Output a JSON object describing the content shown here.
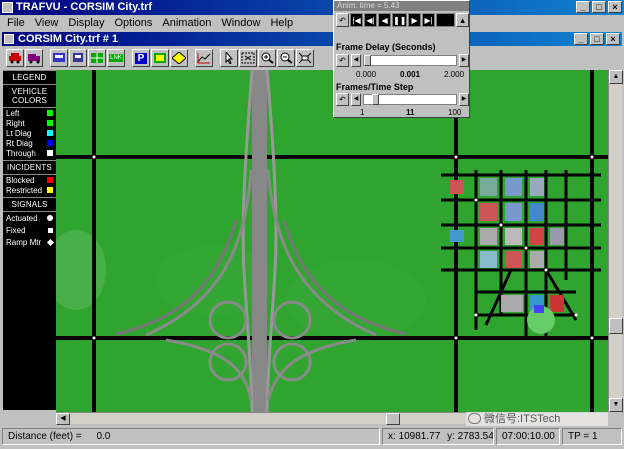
{
  "app": {
    "title": "TRAFVU - CORSIM City.trf",
    "child_title": "CORSIM City.trf # 1"
  },
  "window_buttons": [
    "_",
    "□",
    "×"
  ],
  "menu": [
    "File",
    "View",
    "Display",
    "Options",
    "Animation",
    "Window",
    "Help"
  ],
  "toolbar": {
    "icons": [
      "car-icon",
      "truck-icon",
      "bus-icon",
      "train-icon",
      "grid-icon",
      "lnk-icon",
      "parking-icon",
      "map-icon",
      "signal-icon",
      "graph-icon",
      "pointer-icon",
      "select-icon",
      "zoom-in-icon",
      "zoom-out-icon",
      "fit-icon"
    ],
    "lnk_label": "LNK",
    "parking_label": "P"
  },
  "legend": {
    "title": "LEGEND",
    "vehicle_colors_title": "VEHICLE COLORS",
    "vehicle": [
      {
        "label": "Left",
        "color": "#00ff00"
      },
      {
        "label": "Right",
        "color": "#00ff00"
      },
      {
        "label": "Lt Diag",
        "color": "#00ffff"
      },
      {
        "label": "Rt Diag",
        "color": "#0000ff"
      },
      {
        "label": "Through",
        "color": "#ffffff"
      }
    ],
    "incidents_title": "INCIDENTS",
    "incidents": [
      {
        "label": "Blocked",
        "color": "#ff0000"
      },
      {
        "label": "Restricted",
        "color": "#ffff00"
      }
    ],
    "signals_title": "SIGNALS",
    "signals": [
      {
        "label": "Actuated",
        "shape": "circle"
      },
      {
        "label": "Fixed",
        "shape": "square"
      },
      {
        "label": "Ramp Mtr",
        "shape": "diamond"
      }
    ]
  },
  "animation": {
    "title": "Anim. time = 5.43",
    "frame_delay_label": "Frame Delay (Seconds)",
    "frame_delay_ticks": [
      "0.000",
      "0.001",
      "2.000"
    ],
    "frame_delay_value": 0.001,
    "frames_label": "Frames/Time Step",
    "frames_ticks": [
      "1",
      "11",
      "100"
    ],
    "frames_value": 11
  },
  "status": {
    "distance_label": "Distance (feet) =",
    "distance_value": "0.0",
    "x_label": "x:",
    "x_value": "10981.77",
    "y_label": "y:",
    "y_value": "2783.54",
    "time": "07:00:10.00",
    "tp": "TP = 1"
  },
  "watermark": "微信号:ITSTech"
}
